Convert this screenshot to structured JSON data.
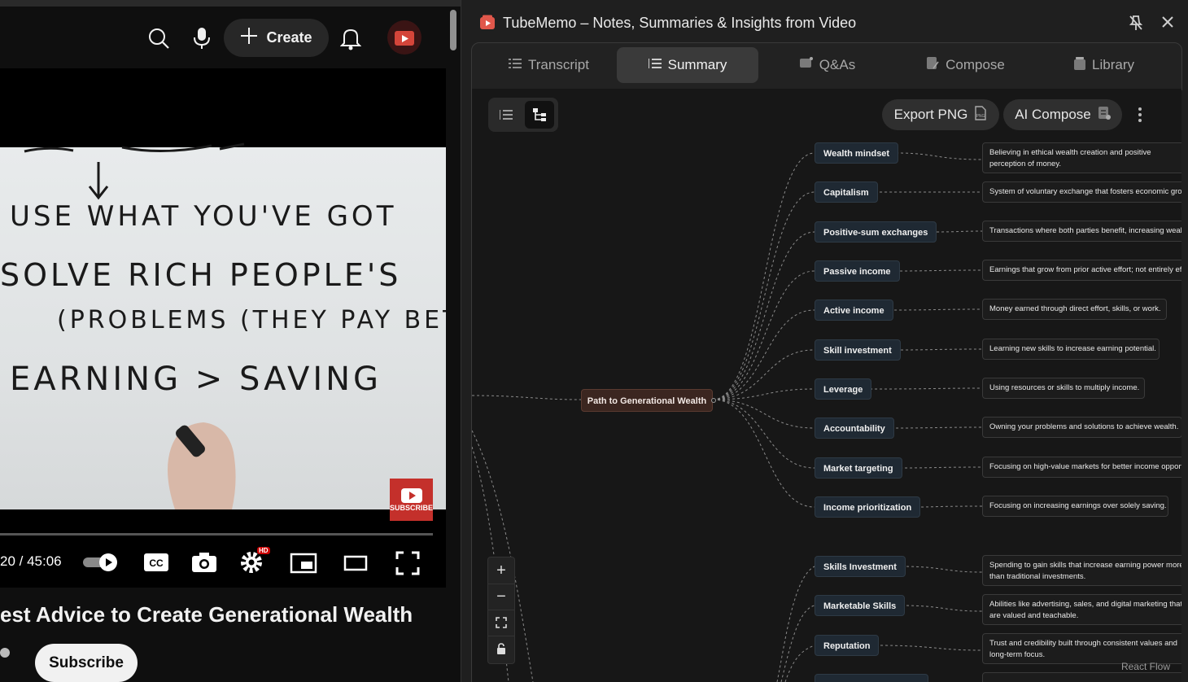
{
  "youtube": {
    "create_label": "Create",
    "timecode": "20 / 45:06",
    "video_title": "est Advice to Create Generational Wealth",
    "subscribe_label": "Subscribe",
    "badge_hd": "HD",
    "subscribe_badge": "SUBSCRIBE",
    "whiteboard_lines": [
      "USE WHAT YOU'VE GOT",
      "SOLVE RICH PEOPLE'S",
      "(PROBLEMS (THEY PAY BETR)",
      "EARNING > SAVING"
    ]
  },
  "tubememo": {
    "title": "TubeMemo – Notes, Summaries & Insights from Video",
    "tabs": [
      {
        "label": "Transcript",
        "active": false
      },
      {
        "label": "Summary",
        "active": true
      },
      {
        "label": "Q&As",
        "active": false
      },
      {
        "label": "Compose",
        "active": false
      },
      {
        "label": "Library",
        "active": false
      }
    ],
    "export_label": "Export PNG",
    "compose_label": "AI Compose",
    "attribution": "React Flow",
    "mindmap": {
      "root": "Path to Generational Wealth",
      "nodes": [
        {
          "label": "Wealth mindset",
          "desc": "Believing in ethical wealth creation and positive perception of money."
        },
        {
          "label": "Capitalism",
          "desc": "System of voluntary exchange that fosters economic growth."
        },
        {
          "label": "Positive-sum exchanges",
          "desc": "Transactions where both parties benefit, increasing wealth."
        },
        {
          "label": "Passive income",
          "desc": "Earnings that grow from prior active effort; not entirely effortless."
        },
        {
          "label": "Active income",
          "desc": "Money earned through direct effort, skills, or work."
        },
        {
          "label": "Skill investment",
          "desc": "Learning new skills to increase earning potential."
        },
        {
          "label": "Leverage",
          "desc": "Using resources or skills to multiply income."
        },
        {
          "label": "Accountability",
          "desc": "Owning your problems and solutions to achieve wealth."
        },
        {
          "label": "Market targeting",
          "desc": "Focusing on high-value markets for better income opportunities."
        },
        {
          "label": "Income prioritization",
          "desc": "Focusing on increasing earnings over solely saving."
        }
      ],
      "nodes2": [
        {
          "label": "Skills Investment",
          "desc": "Spending to gain skills that increase earning power more than traditional investments."
        },
        {
          "label": "Marketable Skills",
          "desc": "Abilities like advertising, sales, and digital marketing that are valued and teachable."
        },
        {
          "label": "Reputation",
          "desc": "Trust and credibility built through consistent values and long-term focus."
        }
      ]
    }
  }
}
